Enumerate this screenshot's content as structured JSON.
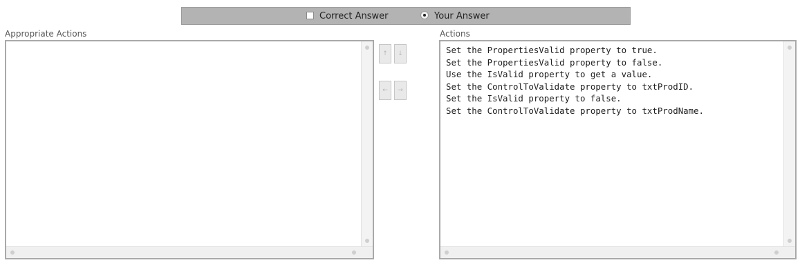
{
  "answer_toggle": {
    "correct_label": "Correct Answer",
    "correct_checked": false,
    "your_label": "Your Answer",
    "your_selected": true
  },
  "left_panel": {
    "label": "Appropriate Actions",
    "items": []
  },
  "right_panel": {
    "label": "Actions",
    "items": [
      "Set the PropertiesValid property to true.",
      "Set the PropertiesValid property to false.",
      "Use the IsValid property to get a value.",
      "Set the ControlToValidate property to txtProdID.",
      "Set the IsValid property to false.",
      "Set the ControlToValidate property to txtProdName."
    ]
  },
  "buttons": {
    "up": "↑",
    "down": "↓",
    "move_left": "←",
    "move_right": "→"
  },
  "colors": {
    "bar_bg": "#b3b3b3",
    "box_border": "#a9a9a9"
  }
}
